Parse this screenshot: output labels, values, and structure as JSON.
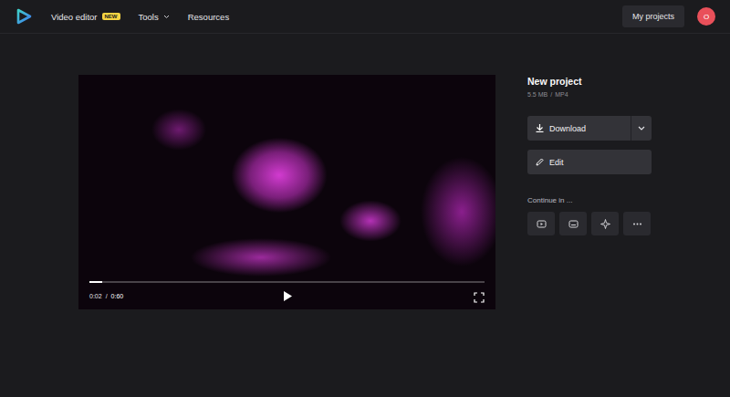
{
  "header": {
    "nav": [
      {
        "label": "Video editor",
        "kind": "link",
        "badge": "NEW"
      },
      {
        "label": "Tools",
        "kind": "menu"
      },
      {
        "label": "Resources",
        "kind": "link"
      }
    ],
    "my_projects": "My projects",
    "avatar": "O"
  },
  "player": {
    "current_time": "0:02",
    "separator": "/",
    "duration": "0:60",
    "level": 0.033,
    "playing": false
  },
  "project": {
    "title": "New project",
    "size": "5.5 MB",
    "separator": "/",
    "format": "MP4"
  },
  "actions": [
    {
      "label": "Download",
      "kind": "split"
    },
    {
      "label": "Edit",
      "kind": "plain"
    }
  ],
  "continue": {
    "label": "Continue in ...",
    "apps": [
      {
        "kind": "youtube"
      },
      {
        "kind": "subtitles"
      },
      {
        "kind": "sparkle"
      },
      {
        "kind": "more"
      }
    ]
  }
}
